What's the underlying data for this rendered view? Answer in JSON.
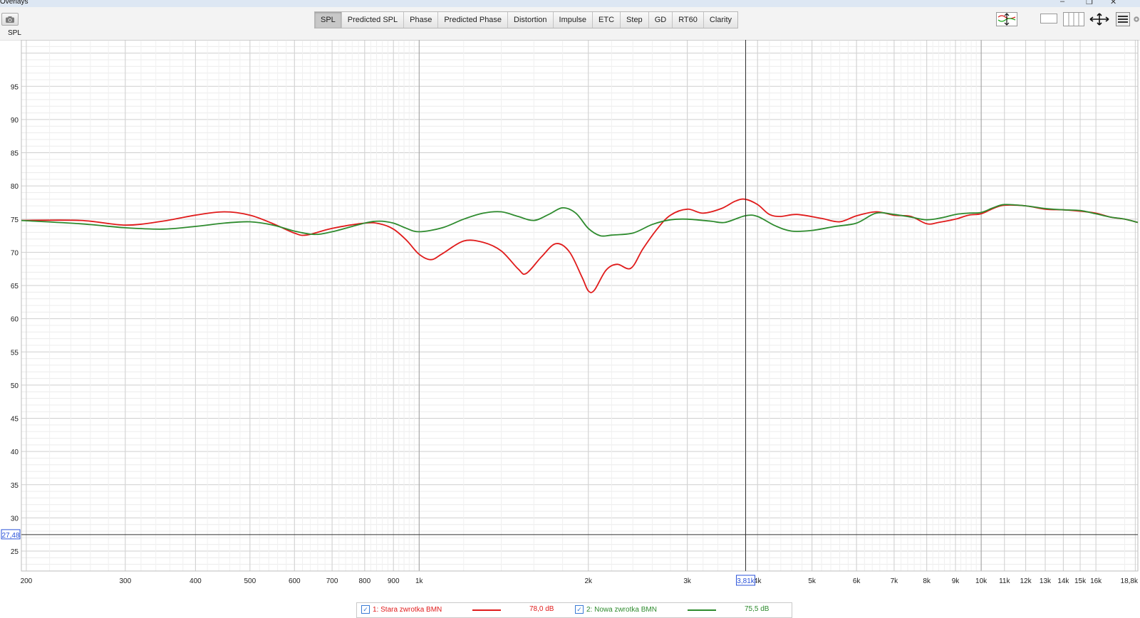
{
  "window": {
    "title": "Overlays",
    "minimize": "–",
    "restore": "❐",
    "close": "✕"
  },
  "toolbar": {
    "camera_icon": "camera-icon",
    "spl_label": "SPL",
    "tabs": [
      "SPL",
      "Predicted SPL",
      "Phase",
      "Predicted Phase",
      "Distortion",
      "Impulse",
      "ETC",
      "Step",
      "GD",
      "RT60",
      "Clarity"
    ],
    "active_tab": "SPL",
    "right_icons": [
      "trace-arrange-icon",
      "single-view-icon",
      "multi-view-icon",
      "pan-zoom-icon",
      "controls-icon",
      "settings-icon"
    ]
  },
  "chart_data": {
    "type": "line",
    "xscale": "log",
    "xlim": [
      196,
      19000
    ],
    "ylim": [
      22,
      102
    ],
    "x_ticks": [
      {
        "v": 200,
        "label": "200"
      },
      {
        "v": 300,
        "label": "300"
      },
      {
        "v": 400,
        "label": "400"
      },
      {
        "v": 500,
        "label": "500"
      },
      {
        "v": 600,
        "label": "600"
      },
      {
        "v": 700,
        "label": "700"
      },
      {
        "v": 800,
        "label": "800"
      },
      {
        "v": 900,
        "label": "900"
      },
      {
        "v": 1000,
        "label": "1k"
      },
      {
        "v": 2000,
        "label": "2k"
      },
      {
        "v": 3000,
        "label": "3k"
      },
      {
        "v": 4000,
        "label": "4k"
      },
      {
        "v": 5000,
        "label": "5k"
      },
      {
        "v": 6000,
        "label": "6k"
      },
      {
        "v": 7000,
        "label": "7k"
      },
      {
        "v": 8000,
        "label": "8k"
      },
      {
        "v": 9000,
        "label": "9k"
      },
      {
        "v": 10000,
        "label": "10k"
      },
      {
        "v": 11000,
        "label": "11k"
      },
      {
        "v": 12000,
        "label": "12k"
      },
      {
        "v": 13000,
        "label": "13k"
      },
      {
        "v": 14000,
        "label": "14k"
      },
      {
        "v": 15000,
        "label": "15k"
      },
      {
        "v": 16000,
        "label": "16k"
      },
      {
        "v": 18800,
        "label": "18,8k"
      }
    ],
    "y_ticks": [
      25,
      30,
      35,
      40,
      45,
      50,
      55,
      60,
      65,
      70,
      75,
      80,
      85,
      90,
      95
    ],
    "cursor": {
      "x": 3810,
      "x_label": "3,81k",
      "y": 27.48,
      "y_label": "27,48"
    },
    "series": [
      {
        "name": "1: Stara zwrotka BMN",
        "color": "#e01b1b",
        "value_label": "78,0 dB",
        "points": [
          [
            196,
            74.8
          ],
          [
            250,
            74.8
          ],
          [
            300,
            74.1
          ],
          [
            350,
            74.7
          ],
          [
            400,
            75.6
          ],
          [
            450,
            76.1
          ],
          [
            500,
            75.6
          ],
          [
            550,
            74.3
          ],
          [
            600,
            72.9
          ],
          [
            630,
            72.6
          ],
          [
            700,
            73.6
          ],
          [
            800,
            74.4
          ],
          [
            850,
            74.3
          ],
          [
            900,
            73.5
          ],
          [
            950,
            71.8
          ],
          [
            1000,
            69.7
          ],
          [
            1050,
            68.9
          ],
          [
            1100,
            69.8
          ],
          [
            1200,
            71.7
          ],
          [
            1300,
            71.5
          ],
          [
            1400,
            70.2
          ],
          [
            1500,
            67.5
          ],
          [
            1550,
            66.8
          ],
          [
            1650,
            69.3
          ],
          [
            1750,
            71.3
          ],
          [
            1850,
            70.1
          ],
          [
            1950,
            66.2
          ],
          [
            2000,
            64.2
          ],
          [
            2050,
            64.3
          ],
          [
            2150,
            67.3
          ],
          [
            2250,
            68.2
          ],
          [
            2380,
            67.6
          ],
          [
            2500,
            70.5
          ],
          [
            2650,
            73.5
          ],
          [
            2800,
            75.6
          ],
          [
            3000,
            76.5
          ],
          [
            3200,
            75.9
          ],
          [
            3450,
            76.6
          ],
          [
            3650,
            77.7
          ],
          [
            3800,
            78.0
          ],
          [
            4000,
            77.2
          ],
          [
            4200,
            75.7
          ],
          [
            4400,
            75.4
          ],
          [
            4700,
            75.7
          ],
          [
            5200,
            75.1
          ],
          [
            5600,
            74.6
          ],
          [
            6000,
            75.5
          ],
          [
            6500,
            76.1
          ],
          [
            7000,
            75.6
          ],
          [
            7500,
            75.4
          ],
          [
            8000,
            74.3
          ],
          [
            8400,
            74.5
          ],
          [
            9000,
            75.0
          ],
          [
            9500,
            75.6
          ],
          [
            10000,
            75.8
          ],
          [
            10500,
            76.6
          ],
          [
            11000,
            77.1
          ],
          [
            12000,
            77.0
          ],
          [
            13000,
            76.5
          ],
          [
            14000,
            76.4
          ],
          [
            15000,
            76.2
          ],
          [
            16000,
            75.9
          ],
          [
            17000,
            75.3
          ],
          [
            18000,
            75.0
          ],
          [
            19000,
            74.5
          ]
        ]
      },
      {
        "name": "2: Nowa zwrotka BMN",
        "color": "#2e8b2e",
        "value_label": "75,5 dB",
        "points": [
          [
            196,
            74.8
          ],
          [
            250,
            74.3
          ],
          [
            300,
            73.7
          ],
          [
            350,
            73.5
          ],
          [
            400,
            73.9
          ],
          [
            450,
            74.4
          ],
          [
            500,
            74.6
          ],
          [
            550,
            74.1
          ],
          [
            600,
            73.2
          ],
          [
            650,
            72.7
          ],
          [
            700,
            73.1
          ],
          [
            800,
            74.4
          ],
          [
            850,
            74.7
          ],
          [
            900,
            74.4
          ],
          [
            950,
            73.6
          ],
          [
            1000,
            73.1
          ],
          [
            1100,
            73.7
          ],
          [
            1200,
            75.0
          ],
          [
            1300,
            75.9
          ],
          [
            1400,
            76.1
          ],
          [
            1500,
            75.4
          ],
          [
            1600,
            74.8
          ],
          [
            1700,
            75.7
          ],
          [
            1800,
            76.7
          ],
          [
            1900,
            75.9
          ],
          [
            2000,
            73.6
          ],
          [
            2100,
            72.5
          ],
          [
            2200,
            72.6
          ],
          [
            2400,
            72.9
          ],
          [
            2600,
            74.2
          ],
          [
            2800,
            74.9
          ],
          [
            3000,
            75.0
          ],
          [
            3300,
            74.7
          ],
          [
            3500,
            74.5
          ],
          [
            3800,
            75.5
          ],
          [
            4000,
            75.4
          ],
          [
            4300,
            74.0
          ],
          [
            4600,
            73.2
          ],
          [
            5000,
            73.3
          ],
          [
            5500,
            73.9
          ],
          [
            6000,
            74.4
          ],
          [
            6500,
            75.9
          ],
          [
            7000,
            75.7
          ],
          [
            7500,
            75.3
          ],
          [
            8000,
            74.9
          ],
          [
            8500,
            75.2
          ],
          [
            9000,
            75.7
          ],
          [
            9500,
            75.9
          ],
          [
            10000,
            76.0
          ],
          [
            10500,
            76.7
          ],
          [
            11000,
            77.2
          ],
          [
            12000,
            77.0
          ],
          [
            13000,
            76.6
          ],
          [
            14000,
            76.4
          ],
          [
            15000,
            76.3
          ],
          [
            16000,
            75.8
          ],
          [
            17000,
            75.3
          ],
          [
            18000,
            75.0
          ],
          [
            19000,
            74.5
          ]
        ]
      }
    ]
  }
}
